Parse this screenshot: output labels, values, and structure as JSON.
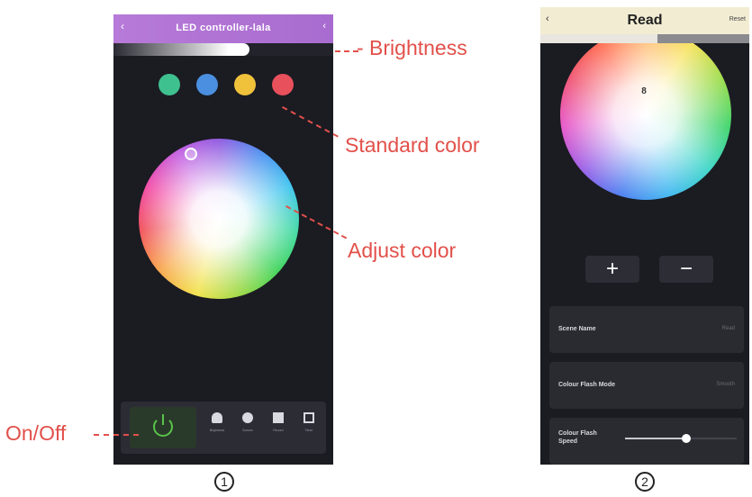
{
  "phone1": {
    "title": "LED controller-lala",
    "back_icon": "‹",
    "menu_icon": "‹",
    "brightness": 0.62,
    "standard_colors": [
      "#3fc08f",
      "#4a8fe0",
      "#f0c23b",
      "#e8505b"
    ],
    "nav": [
      {
        "label": "Brightness",
        "icon": "bulb-icon"
      },
      {
        "label": "Scenes",
        "icon": "palette-icon"
      },
      {
        "label": "Record",
        "icon": "music-icon"
      },
      {
        "label": "Timer",
        "icon": "grid-icon"
      }
    ]
  },
  "phone2": {
    "title": "Read",
    "back_icon": "‹",
    "reset_label": "Reset",
    "marker": "8",
    "plus_label": "+",
    "minus_label": "−",
    "rows": [
      {
        "label": "Scene Name",
        "value": "Read"
      },
      {
        "label": "Colour Flash Mode",
        "value": "Smooth"
      }
    ],
    "speed": {
      "label_line1": "Colour Flash",
      "label_line2": "Speed",
      "value": 0.55
    }
  },
  "annotations": {
    "brightness": "- Brightness",
    "standard_color": "Standard color",
    "adjust_color": "Adjust color",
    "onoff": "On/Off"
  },
  "figure_numbers": [
    "1",
    "2"
  ]
}
